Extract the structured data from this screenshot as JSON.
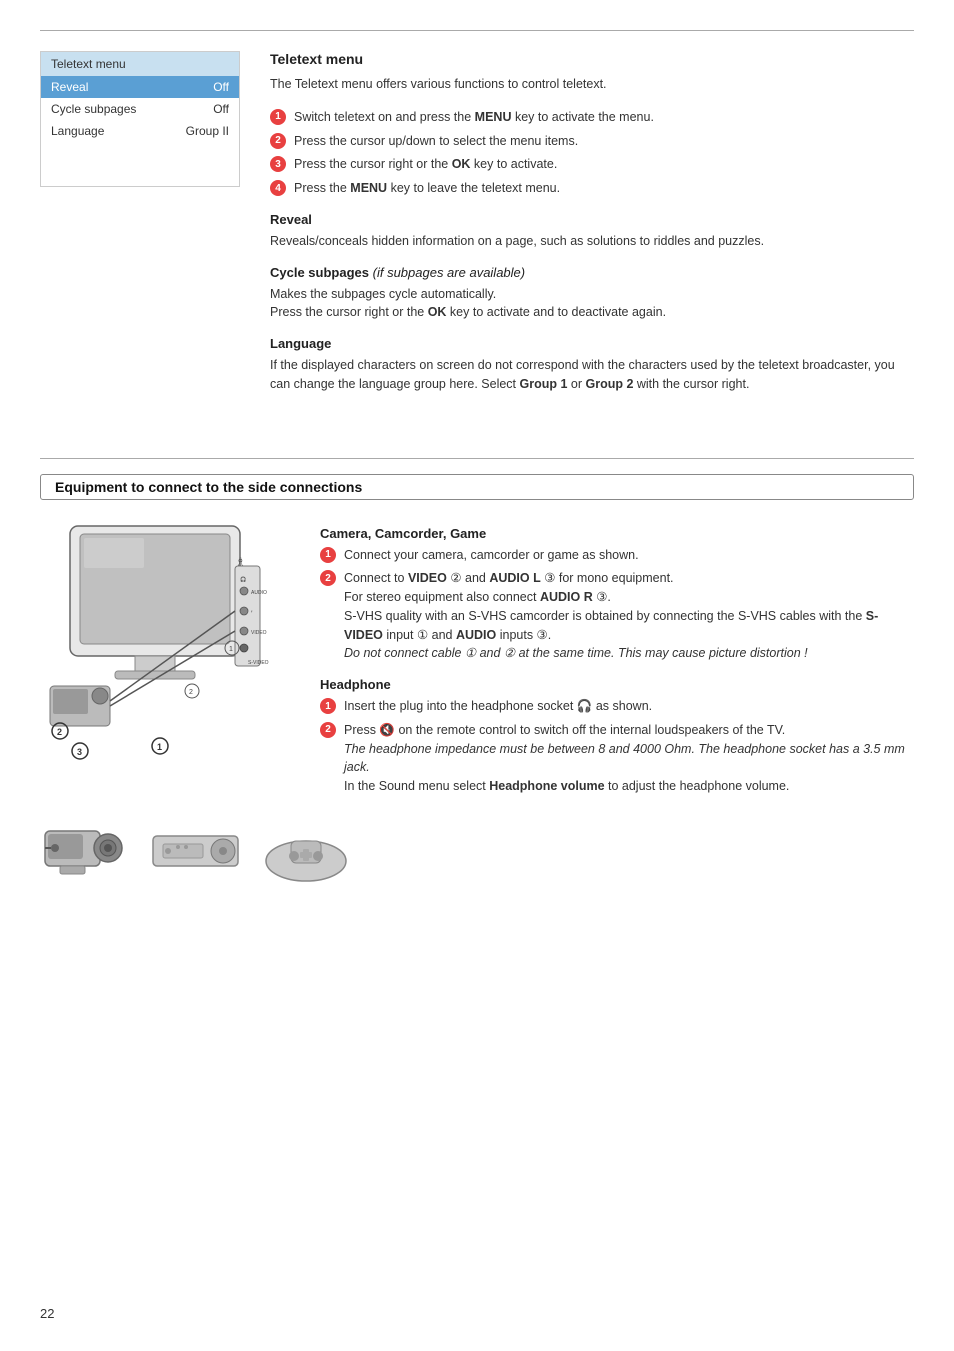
{
  "page": {
    "number": "22"
  },
  "top_rule": true,
  "menu": {
    "title": "Teletext menu",
    "rows": [
      {
        "label": "Reveal",
        "value": "Off",
        "highlight": true
      },
      {
        "label": "Cycle subpages",
        "value": "Off",
        "highlight": false
      },
      {
        "label": "Language",
        "value": "Group II",
        "highlight": false
      }
    ]
  },
  "teletext": {
    "section_title": "Teletext menu",
    "intro": "The Teletext menu offers various functions to control teletext.",
    "steps": [
      {
        "num": "1",
        "text_before": "Switch teletext on and press the ",
        "bold": "MENU",
        "text_after": " key to activate the menu."
      },
      {
        "num": "2",
        "text_before": "Press the cursor up/down to select the menu items.",
        "bold": "",
        "text_after": ""
      },
      {
        "num": "3",
        "text_before": "Press the cursor right or the ",
        "bold": "OK",
        "text_after": " key to activate."
      },
      {
        "num": "4",
        "text_before": "Press the ",
        "bold": "MENU",
        "text_after": " key to leave the teletext menu."
      }
    ],
    "reveal": {
      "title": "Reveal",
      "body": "Reveals/conceals hidden information on a page, such as solutions to riddles and puzzles."
    },
    "cycle_subpages": {
      "title": "Cycle subpages",
      "italic_note": "(if subpages are available)",
      "lines": [
        "Makes the subpages cycle automatically.",
        "Press the cursor right or the <strong>OK</strong> key to activate and to deactivate again."
      ]
    },
    "language": {
      "title": "Language",
      "body": "If the displayed characters on screen do not correspond with the characters used by the teletext broadcaster, you can change the language group here. Select <strong>Group 1</strong> or <strong>Group 2</strong> with the cursor right."
    }
  },
  "equipment": {
    "section_title": "Equipment to connect to the side connections",
    "camera": {
      "title": "Camera, Camcorder, Game",
      "steps": [
        {
          "num": "1",
          "text": "Connect your camera, camcorder or game as shown."
        },
        {
          "num": "2",
          "text": "Connect to <strong>VIDEO</strong> ② and <strong>AUDIO L</strong> ③ for mono equipment. For stereo equipment also connect <strong>AUDIO R</strong> ③. S-VHS quality with an S-VHS camcorder is obtained by connecting the S-VHS cables with the <strong>S-VIDEO</strong> input ① and <strong>AUDIO</strong> inputs ③. <em>Do not connect cable ① and ② at the same time. This may cause picture distortion !</em>"
        }
      ]
    },
    "headphone": {
      "title": "Headphone",
      "steps": [
        {
          "num": "1",
          "text": "Insert the plug into the headphone socket 🎧 as shown."
        },
        {
          "num": "2",
          "text": "Press 🔇 on the remote control to switch off the internal loudspeakers of the TV. <em>The headphone impedance must be between 8 and 4000 Ohm. The headphone socket has a 3.5 mm jack.</em> In the Sound menu select <strong>Headphone volume</strong> to adjust the headphone volume."
        }
      ]
    }
  }
}
